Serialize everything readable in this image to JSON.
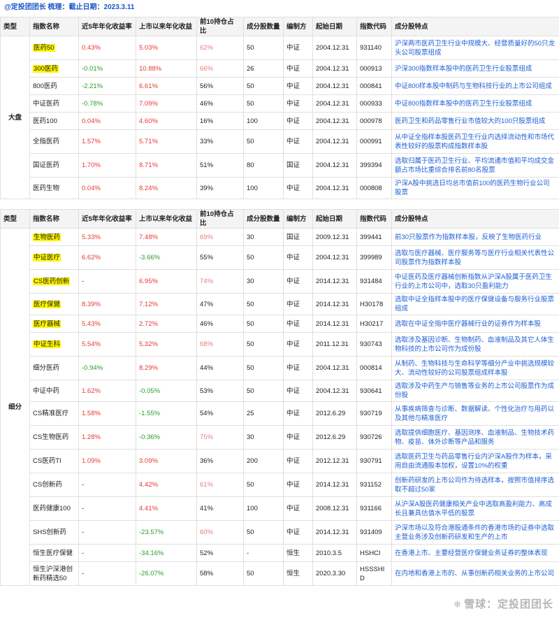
{
  "header": {
    "title": "@定投团团长 梳理：截止日期：2023.3.11"
  },
  "columns": [
    "类型",
    "指数名称",
    "近5年年化收益率",
    "上市以来年化收益",
    "前10持仓占比",
    "成分股数量",
    "编制方",
    "起始日期",
    "指数代码",
    "成分股特点"
  ],
  "sections": [
    {
      "type": "大盘",
      "rows": [
        {
          "name": "医药50",
          "hl": true,
          "r5": "0.43%",
          "r5c": "red",
          "rs": "5.03%",
          "rsc": "red",
          "top10": "62%",
          "t10c": "pink",
          "count": "50",
          "org": "中证",
          "date": "2004.12.31",
          "code": "931140",
          "feat": "沪深两市医药卫生行业中规模大、经营质量好的50只龙头公司股票组成"
        },
        {
          "name": "300医药",
          "hl": true,
          "r5": "-0.01%",
          "r5c": "green",
          "rs": "10.88%",
          "rsc": "red",
          "top10": "66%",
          "t10c": "pink",
          "count": "26",
          "org": "中证",
          "date": "2004.12.31",
          "code": "000913",
          "feat": "沪深300指数样本股中的医药卫生行业股票组成"
        },
        {
          "name": "800医药",
          "hl": false,
          "r5": "-2.21%",
          "r5c": "green",
          "rs": "6.61%",
          "rsc": "red",
          "top10": "56%",
          "t10c": "",
          "count": "50",
          "org": "中证",
          "date": "2004.12.31",
          "code": "000841",
          "feat": "中证800样本股中制药与生物科技行业的上市公司组成"
        },
        {
          "name": "中证医药",
          "hl": false,
          "r5": "-0.78%",
          "r5c": "green",
          "rs": "7.09%",
          "rsc": "red",
          "top10": "46%",
          "t10c": "",
          "count": "50",
          "org": "中证",
          "date": "2004.12.31",
          "code": "000933",
          "feat": "中证800指数样本股中的医药卫生行业股票组成"
        },
        {
          "name": "医药100",
          "hl": false,
          "r5": "0.04%",
          "r5c": "red",
          "rs": "4.60%",
          "rsc": "red",
          "top10": "16%",
          "t10c": "",
          "count": "100",
          "org": "中证",
          "date": "2004.12.31",
          "code": "000978",
          "feat": "医药卫生和药品零售行业市值较大的100只股票组成"
        },
        {
          "name": "全指医药",
          "hl": false,
          "r5": "1.57%",
          "r5c": "red",
          "rs": "5.71%",
          "rsc": "red",
          "top10": "33%",
          "t10c": "",
          "count": "50",
          "org": "中证",
          "date": "2004.12.31",
          "code": "000991",
          "feat": "从中证全指样本股医药卫生行业内选择流动性和市场代表性较好的股票构成指数样本股"
        },
        {
          "name": "国证医药",
          "hl": false,
          "r5": "1.70%",
          "r5c": "red",
          "rs": "8.71%",
          "rsc": "red",
          "top10": "51%",
          "t10c": "",
          "count": "80",
          "org": "国证",
          "date": "2004.12.31",
          "code": "399394",
          "feat": "选取归属于医药卫生行业、平均流通市值和平均成交金额占市场比重综合排名前80名股票"
        },
        {
          "name": "医药生物",
          "hl": false,
          "r5": "0.04%",
          "r5c": "red",
          "rs": "8.24%",
          "rsc": "red",
          "top10": "39%",
          "t10c": "",
          "count": "100",
          "org": "中证",
          "date": "2004.12.31",
          "code": "000808",
          "feat": "沪深A股中挑选日均总市值前100的医药生物行业公司股票"
        }
      ]
    },
    {
      "type": "细分",
      "rows": [
        {
          "name": "生物医药",
          "hl": true,
          "r5": "5.33%",
          "r5c": "red",
          "rs": "7.48%",
          "rsc": "red",
          "top10": "69%",
          "t10c": "pink",
          "count": "30",
          "org": "国证",
          "date": "2009.12.31",
          "code": "399441",
          "feat": "前30只股票作为指数样本股，反映了生物医药行业"
        },
        {
          "name": "中证医疗",
          "hl": true,
          "r5": "6.62%",
          "r5c": "red",
          "rs": "-3.66%",
          "rsc": "green",
          "top10": "55%",
          "t10c": "",
          "count": "50",
          "org": "中证",
          "date": "2004.12.31",
          "code": "399989",
          "feat": "选取与医疗器械、医疗服务等与医疗行业相关代表性公司股票作为指数样本股"
        },
        {
          "name": "CS医药创新",
          "hl": true,
          "r5": "-",
          "r5c": "",
          "rs": "6.95%",
          "rsc": "red",
          "top10": "74%",
          "t10c": "pink",
          "count": "30",
          "org": "中证",
          "date": "2014.12.31",
          "code": "931484",
          "feat": "中证医药及医疗器械创新指数从沪深A股属于医药卫生行业的上市公司中，选取30只盈利能力"
        },
        {
          "name": "医疗保健",
          "hl": true,
          "r5": "8.39%",
          "r5c": "red",
          "rs": "7.12%",
          "rsc": "red",
          "top10": "47%",
          "t10c": "",
          "count": "50",
          "org": "中证",
          "date": "2014.12.31",
          "code": "H30178",
          "feat": "选取中证全指样本股中的医疗保健设备与服务行业股票组成"
        },
        {
          "name": "医疗器械",
          "hl": true,
          "r5": "5.43%",
          "r5c": "red",
          "rs": "2.72%",
          "rsc": "red",
          "top10": "46%",
          "t10c": "",
          "count": "50",
          "org": "中证",
          "date": "2014.12.31",
          "code": "H30217",
          "feat": "选取在中证全指中医疗器械行业的证券作为样本股"
        },
        {
          "name": "中证生科",
          "hl": true,
          "r5": "5.54%",
          "r5c": "red",
          "rs": "5.32%",
          "rsc": "red",
          "top10": "68%",
          "t10c": "pink",
          "count": "50",
          "org": "中证",
          "date": "2011.12.31",
          "code": "930743",
          "feat": "选取涉及基因诊断、生物制药、血液制品及其它人体生物科技的上市公司作为成份股"
        },
        {
          "name": "细分医药",
          "hl": false,
          "r5": "-0.94%",
          "r5c": "green",
          "rs": "8.29%",
          "rsc": "red",
          "top10": "44%",
          "t10c": "",
          "count": "50",
          "org": "中证",
          "date": "2004.12.31",
          "code": "000814",
          "feat": "从制药、生物科技与生命科学等细分产业中挑选规模较大、流动性较好的公司股票组成样本股"
        },
        {
          "name": "中证中药",
          "hl": false,
          "r5": "1.62%",
          "r5c": "red",
          "rs": "-0.05%",
          "rsc": "green",
          "top10": "53%",
          "t10c": "",
          "count": "50",
          "org": "中证",
          "date": "2004.12.31",
          "code": "930641",
          "feat": "选取涉及中药生产与销售等业务的上市公司股票作为成份股"
        },
        {
          "name": "CS精准医疗",
          "hl": false,
          "r5": "1.58%",
          "r5c": "red",
          "rs": "-1.55%",
          "rsc": "green",
          "top10": "54%",
          "t10c": "",
          "count": "25",
          "org": "中证",
          "date": "2012.6.29",
          "code": "930719",
          "feat": "从事疾病筛查与诊断、数据解读、个性化治疗与用药以及其他与精准医疗"
        },
        {
          "name": "CS生物医药",
          "hl": false,
          "r5": "1.28%",
          "r5c": "red",
          "rs": "-0.36%",
          "rsc": "green",
          "top10": "75%",
          "t10c": "pink",
          "count": "30",
          "org": "中证",
          "date": "2012.6.29",
          "code": "930726",
          "feat": "选取提供细胞医疗、基因测序、血液制品、生物技术药物、疫苗、体外诊断等产品和服务"
        },
        {
          "name": "CS医药TI",
          "hl": false,
          "r5": "1.09%",
          "r5c": "red",
          "rs": "3.09%",
          "rsc": "red",
          "top10": "36%",
          "t10c": "",
          "count": "200",
          "org": "中证",
          "date": "2012.12.31",
          "code": "930791",
          "feat": "选取医药卫生与药品零售行业内沪深A股作为样本，采用自由流通股本加权，设置10%的权重"
        },
        {
          "name": "CS创新药",
          "hl": false,
          "r5": "-",
          "r5c": "",
          "rs": "4.42%",
          "rsc": "red",
          "top10": "61%",
          "t10c": "pink",
          "count": "50",
          "org": "中证",
          "date": "2014.12.31",
          "code": "931152",
          "feat": "创新药研发的上市公司作为待选样本，按照市值排序选取不超过50家"
        },
        {
          "name": "医药健康100",
          "hl": false,
          "r5": "-",
          "r5c": "",
          "rs": "4.41%",
          "rsc": "red",
          "top10": "41%",
          "t10c": "",
          "count": "100",
          "org": "中证",
          "date": "2008.12.31",
          "code": "931166",
          "feat": "从沪深A股医药健康相关产业中选取高盈利能力、高成长且兼具估值水平低的股票"
        },
        {
          "name": "SHS创新药",
          "hl": false,
          "r5": "-",
          "r5c": "",
          "rs": "-23.57%",
          "rsc": "green",
          "top10": "60%",
          "t10c": "pink",
          "count": "50",
          "org": "中证",
          "date": "2014.12.31",
          "code": "931409",
          "feat": "沪深市场以及符合港股通条件的香港市场的证券中选取主营业务涉及创新药研发和生产的上市"
        },
        {
          "name": "恒生医疗保健",
          "hl": false,
          "r5": "-",
          "r5c": "",
          "rs": "-34.16%",
          "rsc": "green",
          "top10": "52%",
          "t10c": "",
          "count": "-",
          "org": "恒生",
          "date": "2010.3.5",
          "code": "HSHCI",
          "feat": "在香港上市、主要经营医疗保健业务证券的整体表现"
        },
        {
          "name": "恒生沪深港创新药精选50",
          "hl": false,
          "r5": "-",
          "r5c": "",
          "rs": "-26.07%",
          "rsc": "green",
          "top10": "58%",
          "t10c": "",
          "count": "50",
          "org": "恒生",
          "date": "2020.3.30",
          "code": "HSSSHID",
          "feat": "在内地和香港上市的、从事创新药相关业务的上市公司"
        }
      ]
    }
  ],
  "watermark": {
    "text": "雪球：定投团团长"
  }
}
